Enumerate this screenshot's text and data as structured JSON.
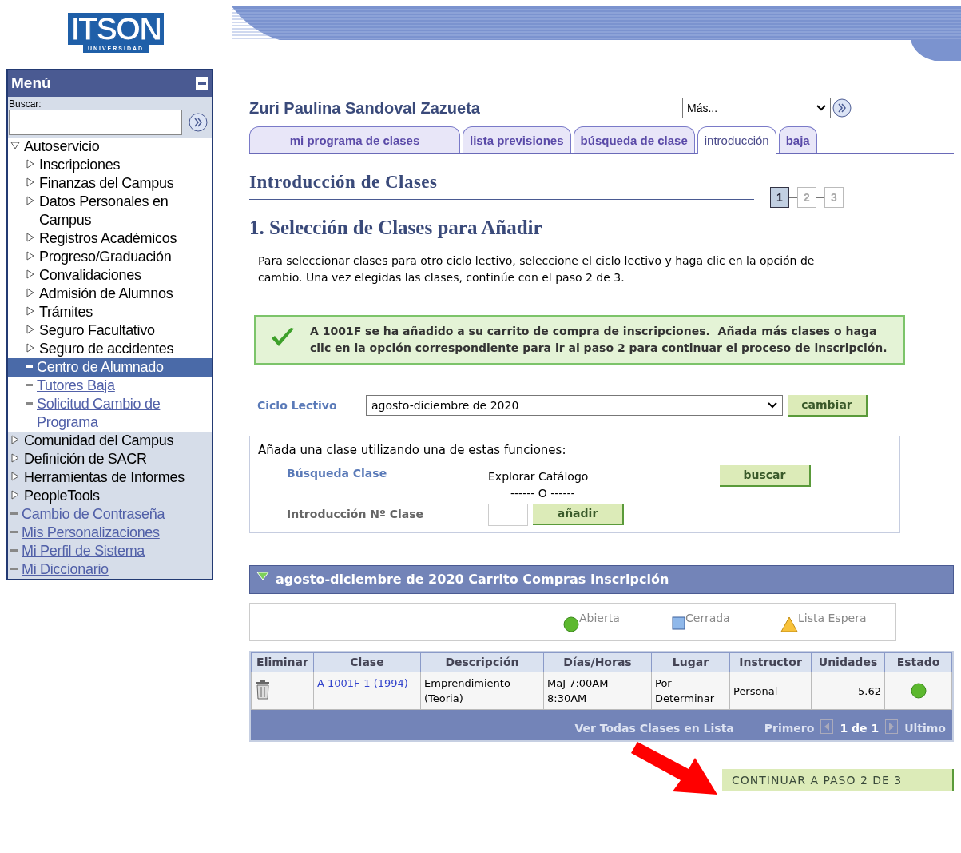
{
  "logo": {
    "name": "ITSON",
    "subtitle": "UNIVERSIDAD"
  },
  "menu": {
    "title": "Menú",
    "search_label": "Buscar:",
    "items": [
      {
        "label": "Autoservicio",
        "kind": "folder",
        "expanded": true,
        "selected": false,
        "children": [
          {
            "label": "Inscripciones",
            "kind": "folder",
            "expanded": false,
            "selected": false
          },
          {
            "label": "Finanzas del Campus",
            "kind": "folder",
            "expanded": false,
            "selected": false
          },
          {
            "label": "Datos Personales en Campus",
            "kind": "folder",
            "expanded": false,
            "selected": false
          },
          {
            "label": "Registros Académicos",
            "kind": "folder",
            "expanded": false,
            "selected": false
          },
          {
            "label": "Progreso/Graduación",
            "kind": "folder",
            "expanded": false,
            "selected": false
          },
          {
            "label": "Convalidaciones",
            "kind": "folder",
            "expanded": false,
            "selected": false
          },
          {
            "label": "Admisión de Alumnos",
            "kind": "folder",
            "expanded": false,
            "selected": false
          },
          {
            "label": "Trámites",
            "kind": "folder",
            "expanded": false,
            "selected": false
          },
          {
            "label": "Seguro Facultativo",
            "kind": "folder",
            "expanded": false,
            "selected": false
          },
          {
            "label": "Seguro de accidentes",
            "kind": "folder",
            "expanded": false,
            "selected": false
          },
          {
            "label": "Centro de Alumnado",
            "kind": "link",
            "selected": true
          },
          {
            "label": "Tutores Baja",
            "kind": "link",
            "selected": false
          },
          {
            "label": "Solicitud Cambio de Programa",
            "kind": "link",
            "selected": false
          }
        ]
      },
      {
        "label": "Comunidad del Campus",
        "kind": "folder",
        "expanded": false,
        "selected": false
      },
      {
        "label": "Definición de SACR",
        "kind": "folder",
        "expanded": false,
        "selected": false
      },
      {
        "label": "Herramientas de Informes",
        "kind": "folder",
        "expanded": false,
        "selected": false
      },
      {
        "label": "PeopleTools",
        "kind": "folder",
        "expanded": false,
        "selected": false
      },
      {
        "label": "Cambio de Contraseña",
        "kind": "link",
        "selected": false
      },
      {
        "label": "Mis Personalizaciones",
        "kind": "link",
        "selected": false
      },
      {
        "label": "Mi Perfil de Sistema",
        "kind": "link",
        "selected": false
      },
      {
        "label": "Mi Diccionario",
        "kind": "link",
        "selected": false
      }
    ]
  },
  "student_name": "Zuri Paulina Sandoval Zazueta",
  "more_select": {
    "value": "Más..."
  },
  "tabs": [
    {
      "label": "mi programa de clases",
      "selected": false
    },
    {
      "label": "lista previsiones",
      "selected": false
    },
    {
      "label": "búsqueda de clase",
      "selected": false
    },
    {
      "label": "introducción",
      "selected": true
    },
    {
      "label": "baja",
      "selected": false
    }
  ],
  "page_title": "Introducción de Clases",
  "steps": [
    {
      "label": "1",
      "selected": true
    },
    {
      "label": "2",
      "selected": false
    },
    {
      "label": "3",
      "selected": false
    }
  ],
  "section_title": "1. Selección de Clases para Añadir",
  "instructions": "Para seleccionar clases para otro ciclo lectivo, seleccione el ciclo lectivo y haga clic en la opción de cambio. Una vez elegidas las clases, continúe con el paso 2 de 3.",
  "success_message": "A 1001F se ha añadido a su carrito de compra de inscripciones.  Añada más clases o haga clic en la opción correspondiente para ir al paso 2 para continuar el proceso de inscripción.",
  "term": {
    "label": "Ciclo Lectivo",
    "value": "agosto-diciembre de 2020",
    "button": "cambiar"
  },
  "add_class": {
    "intro": "Añada una clase utilizando una de estas funciones:",
    "search_label": "Búsqueda Clase",
    "browse": "Explorar Catálogo",
    "or": "------ O ------",
    "search_button": "buscar",
    "entry_label": "Introducción Nº Clase",
    "add_button": "añadir"
  },
  "cart": {
    "title": "agosto-diciembre de 2020 Carrito Compras Inscripción",
    "legend": [
      {
        "kind": "circle",
        "label": "Abierta"
      },
      {
        "kind": "square",
        "label": "Cerrada"
      },
      {
        "kind": "triangle",
        "label": "Lista Espera"
      }
    ],
    "columns": [
      "Eliminar",
      "Clase",
      "Descripción",
      "Días/Horas",
      "Lugar",
      "Instructor",
      "Unidades",
      "Estado"
    ],
    "rows": [
      {
        "class": "A 1001F-1 (1994)",
        "description": "Emprendimiento (Teoria)",
        "schedule": "MaJ 7:00AM - 8:30AM",
        "room": "Por Determinar",
        "instructor": "Personal",
        "units": "5.62",
        "open": true
      }
    ],
    "footer": {
      "view_all": "Ver Todas Clases en Lista",
      "first": "Primero",
      "count": "1 de 1",
      "last": "Ultimo"
    }
  },
  "continue_button": "CONTINUAR A PASO 2 DE 3"
}
